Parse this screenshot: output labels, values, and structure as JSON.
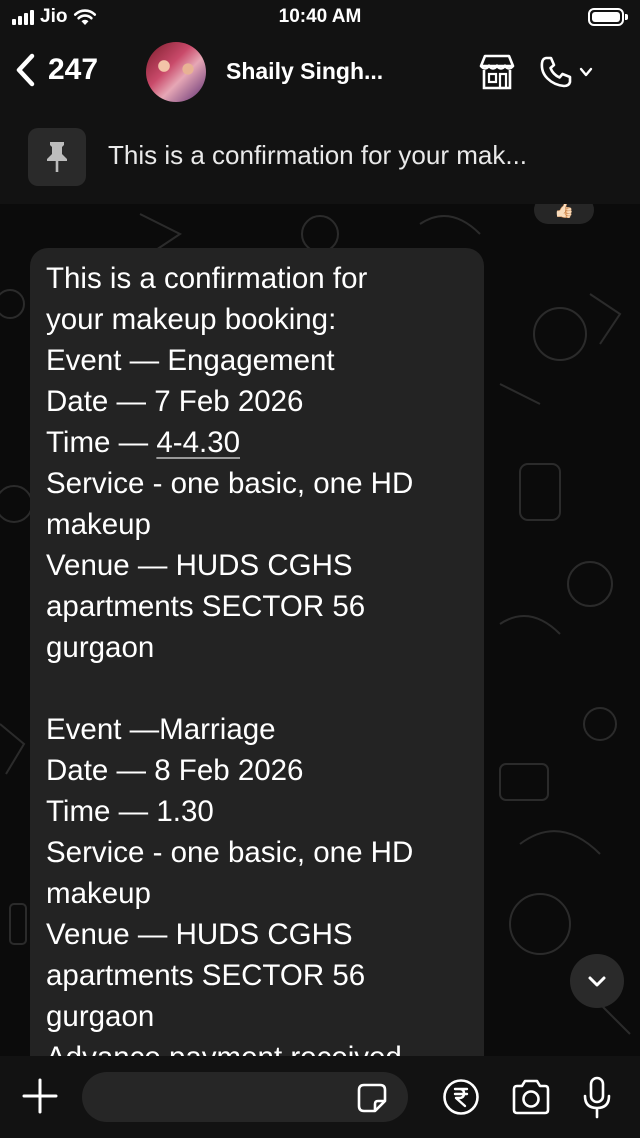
{
  "status_bar": {
    "carrier": "Jio",
    "time": "10:40 AM",
    "icons": [
      "signal-icon",
      "wifi-icon",
      "battery-icon"
    ]
  },
  "header": {
    "unread_count": "247",
    "contact_name": "Shaily Singh...",
    "icons": [
      "back-chevron-icon",
      "shop-icon",
      "phone-icon",
      "chevron-down-icon"
    ]
  },
  "pinned": {
    "text": "This is a confirmation for your mak...",
    "icon": "pin-icon"
  },
  "chat": {
    "reaction": "👍🏻",
    "message_lines": [
      "This is a confirmation for",
      "your makeup booking:",
      "Event — Engagement",
      "Date — 7 Feb 2026",
      "Time — ",
      "Service - one basic, one HD",
      "makeup",
      "Venue — HUDS CGHS",
      "apartments SECTOR 56",
      "gurgaon",
      "",
      "Event —Marriage",
      "Date — 8 Feb 2026",
      "Time — 1.30",
      "Service - one basic, one HD",
      "makeup",
      "Venue — HUDS CGHS",
      "apartments SECTOR 56",
      "gurgaon",
      "Advance payment received"
    ],
    "time_link": "4-4.30",
    "scroll_icon": "chevron-down-icon"
  },
  "composer": {
    "placeholder": "",
    "icons": [
      "plus-icon",
      "sticker-icon",
      "rupee-icon",
      "camera-icon",
      "mic-icon"
    ]
  },
  "colors": {
    "background": "#0b0b0b",
    "bars": "#121212",
    "bubble": "#232323",
    "text": "#ffffff"
  }
}
